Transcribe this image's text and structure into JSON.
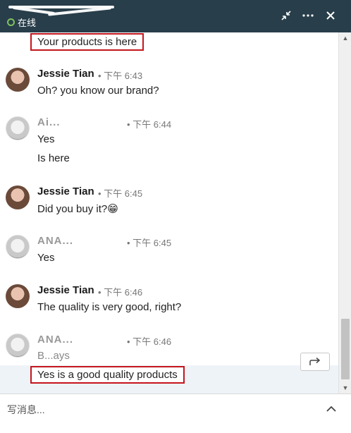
{
  "header": {
    "status_text": "在线",
    "collapse_label": "⤡",
    "more_label": "···",
    "close_label": "✕"
  },
  "messages": {
    "top_highlight": "Your products is here",
    "g1": {
      "sender": "Jessie Tian",
      "time": "下午 6:43",
      "line1": "Oh? you know our brand?"
    },
    "g2": {
      "sender": "Ai...",
      "time": "下午 6:44",
      "line1": "Yes",
      "line2": "Is here"
    },
    "g3": {
      "sender": "Jessie Tian",
      "time": "下午 6:45",
      "line1": "Did you buy it?😁"
    },
    "g4": {
      "sender": "ANA...",
      "time": "下午 6:45",
      "line1": "Yes"
    },
    "g5": {
      "sender": "Jessie Tian",
      "time": "下午 6:46",
      "line1": "The quality is very good, right?"
    },
    "g6": {
      "sender": "ANA...",
      "time": "下午 6:46",
      "line1": "B...ays"
    },
    "bottom_highlight": "Yes is a good quality products"
  },
  "composer": {
    "placeholder": "写消息..."
  },
  "colors": {
    "header_bg": "#283e4a",
    "online_green": "#7fc15e",
    "highlight_red": "#c4161c"
  }
}
